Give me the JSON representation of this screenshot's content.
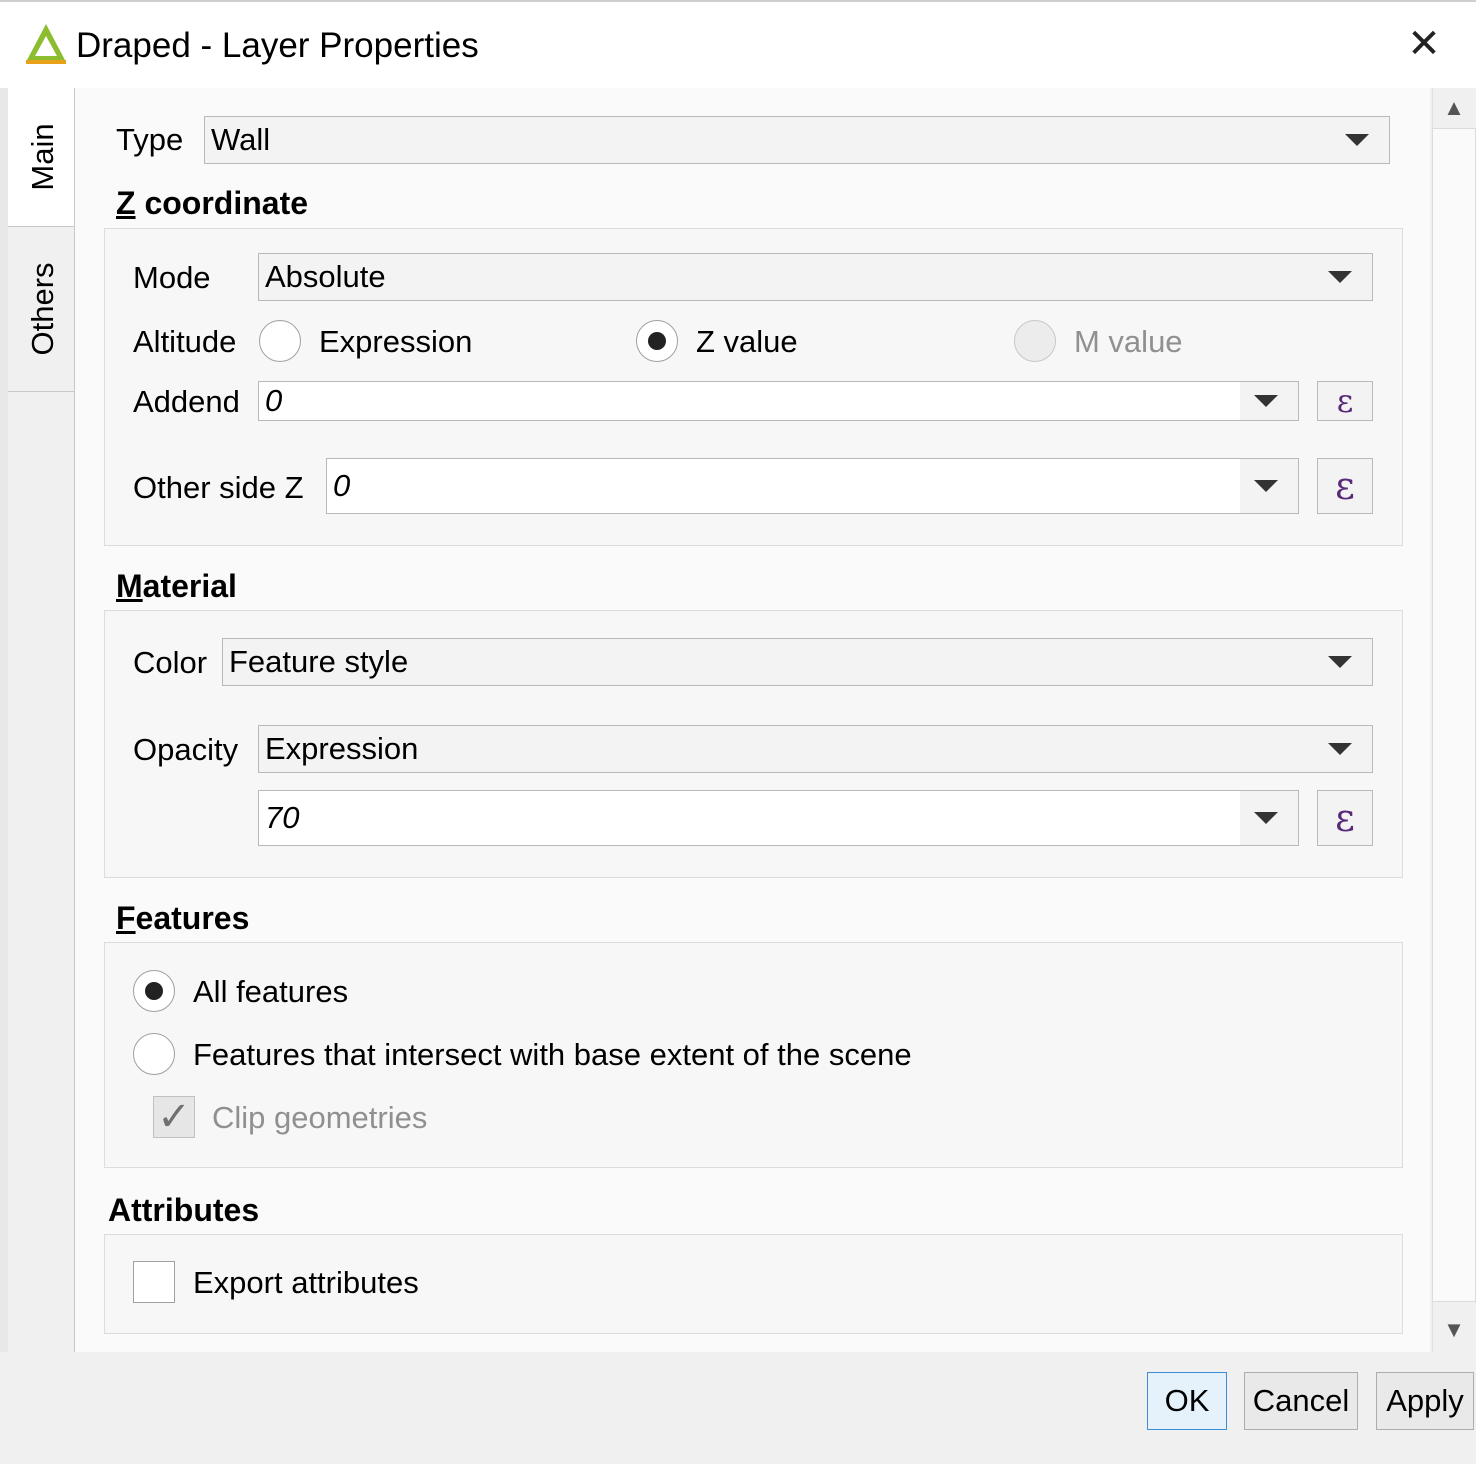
{
  "window": {
    "title": "Draped - Layer Properties",
    "close_glyph": "✕",
    "logo_icon": "qgis3-logo-icon"
  },
  "tabs": [
    {
      "label": "Main",
      "selected": true
    },
    {
      "label": "Others",
      "selected": false
    }
  ],
  "main": {
    "type_label": "Type",
    "type_value": "Wall",
    "z_section": {
      "title_mnemonic": "Z",
      "title_rest": " coordinate",
      "mode_label": "Mode",
      "mode_value": "Absolute",
      "altitude_label": "Altitude",
      "altitude_options": [
        {
          "label": "Expression",
          "checked": false,
          "enabled": true
        },
        {
          "label": "Z value",
          "checked": true,
          "enabled": true
        },
        {
          "label": "M value",
          "checked": false,
          "enabled": false
        }
      ],
      "addend_label": "Addend",
      "addend_value": "0",
      "other_side_label": "Other side Z",
      "other_side_value": "0",
      "expression_icon": "ε"
    },
    "material": {
      "title_mnemonic": "M",
      "title_rest": "aterial",
      "color_label": "Color",
      "color_value": "Feature style",
      "opacity_label": "Opacity",
      "opacity_mode": "Expression",
      "opacity_value": "70",
      "expression_icon": "ε"
    },
    "features": {
      "title_mnemonic": "F",
      "title_rest": "eatures",
      "options": [
        {
          "label": "All features",
          "checked": true
        },
        {
          "label": "Features that intersect with base extent of the scene",
          "checked": false
        }
      ],
      "clip_label": "Clip geometries",
      "clip_checked": true,
      "clip_enabled": false,
      "check_glyph": "✓"
    },
    "attributes": {
      "title": "Attributes",
      "export_label": "Export attributes",
      "export_checked": false
    }
  },
  "scrollbar": {
    "up_glyph": "▲",
    "down_glyph": "▼"
  },
  "buttons": {
    "ok": "OK",
    "cancel": "Cancel",
    "apply": "Apply"
  }
}
